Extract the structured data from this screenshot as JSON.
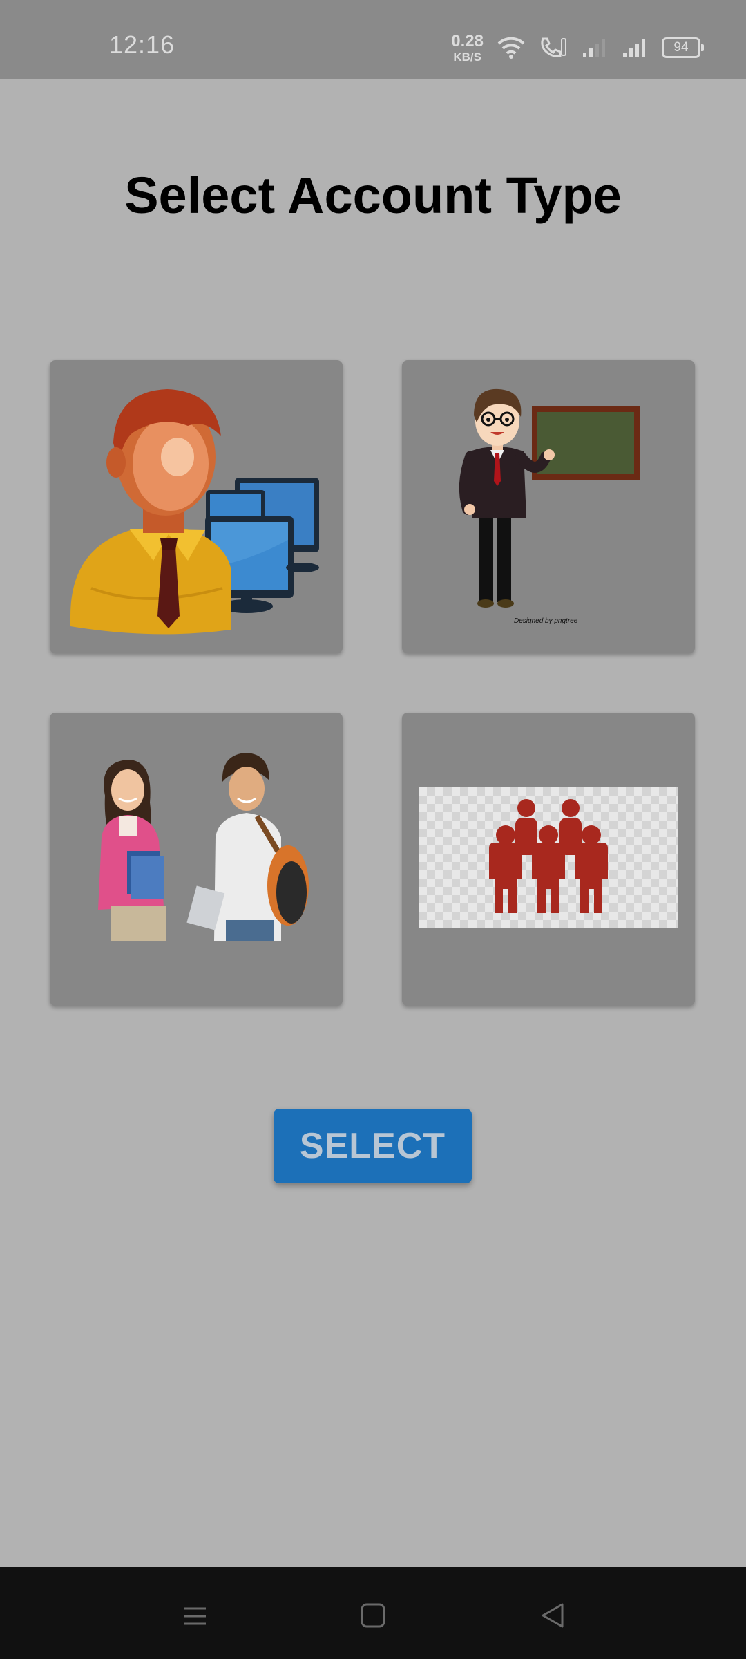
{
  "status_bar": {
    "time": "12:16",
    "net_speed_value": "0.28",
    "net_speed_unit": "KB/S",
    "battery": "94",
    "icons": [
      "wifi-icon",
      "volte-call-icon",
      "signal-icon",
      "signal-icon"
    ]
  },
  "page": {
    "title": "Select Account Type"
  },
  "account_types": [
    {
      "icon": "admin-icon"
    },
    {
      "icon": "teacher-icon",
      "watermark": "Designed by pngtree"
    },
    {
      "icon": "students-icon"
    },
    {
      "icon": "group-icon"
    }
  ],
  "select_button": {
    "label": "SELECT",
    "color": "#1c70b8"
  },
  "nav_bar": {
    "icons": [
      "menu-icon",
      "home-icon",
      "back-icon"
    ]
  }
}
